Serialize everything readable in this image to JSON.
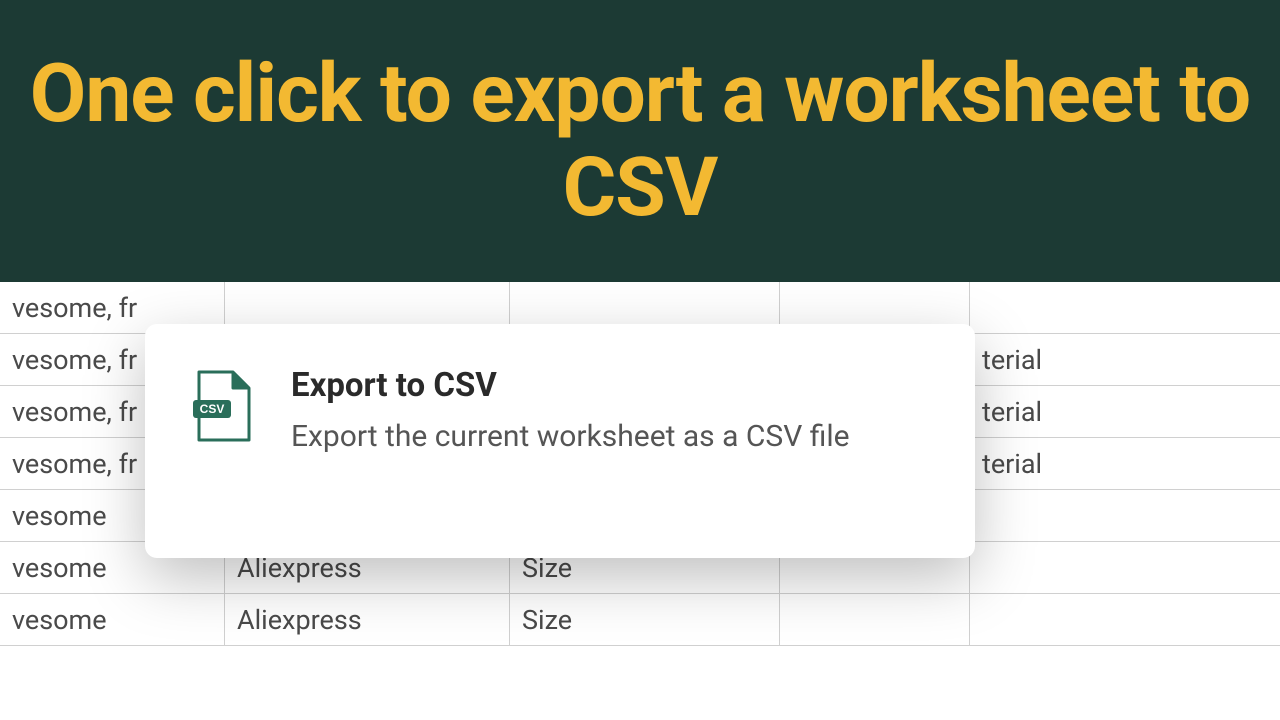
{
  "banner": {
    "text": "One click to export a worksheet to CSV"
  },
  "popup": {
    "title": "Export to CSV",
    "description": "Export the current worksheet as a CSV file",
    "icon_label": "CSV"
  },
  "table": {
    "rows": [
      {
        "c1": "vesome, fr",
        "c2": "",
        "c3": "",
        "c4": "",
        "c5": ""
      },
      {
        "c1": "vesome, fr",
        "c2": "",
        "c3": "",
        "c4": "",
        "c5": "terial"
      },
      {
        "c1": "vesome, fr",
        "c2": "",
        "c3": "",
        "c4": "",
        "c5": "terial"
      },
      {
        "c1": "vesome, fr",
        "c2": "",
        "c3": "",
        "c4": "",
        "c5": "terial"
      },
      {
        "c1": "vesome",
        "c2": "",
        "c3": "",
        "c4": "",
        "c5": ""
      },
      {
        "c1": "vesome",
        "c2": "Aliexpress",
        "c3": "Size",
        "c4": "",
        "c5": ""
      },
      {
        "c1": "vesome",
        "c2": "Aliexpress",
        "c3": "Size",
        "c4": "",
        "c5": ""
      }
    ]
  }
}
